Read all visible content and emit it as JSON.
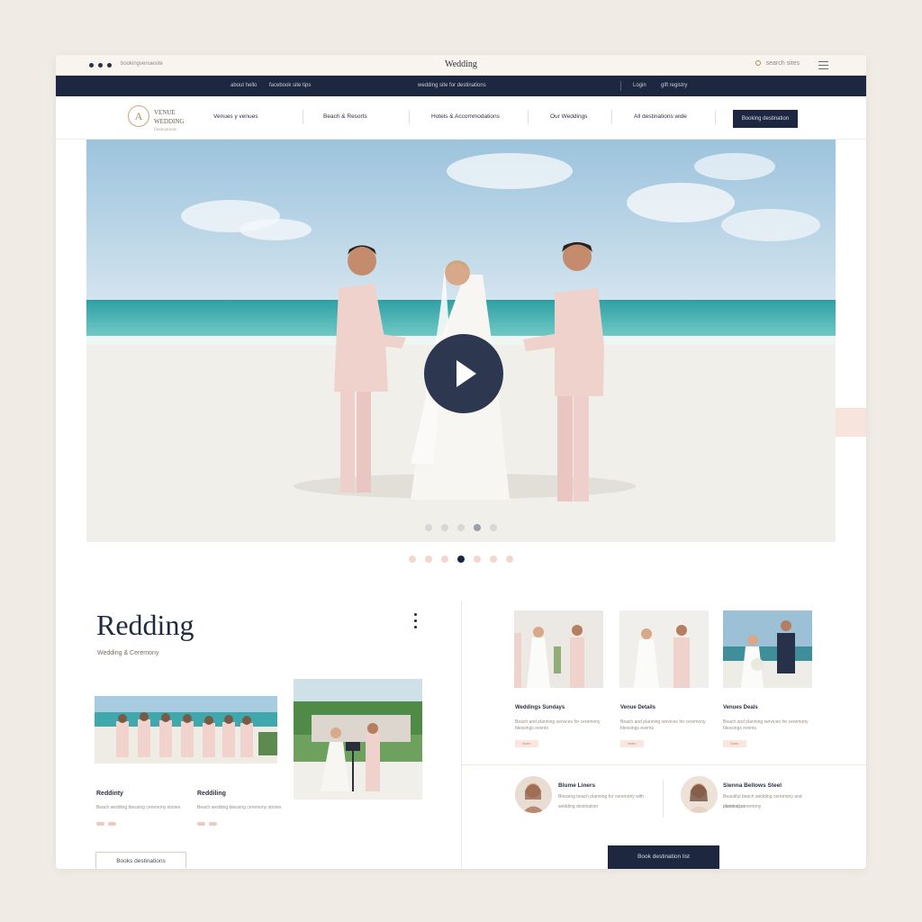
{
  "chrome": {
    "url": "bookingvenuesite",
    "title": "Wedding",
    "search_label": "search sites",
    "menu_icon": "hamburger-icon"
  },
  "topbar": {
    "item1": "about hello",
    "item2": "facebook site tips",
    "item3": "wedding site for destinations",
    "item4": "Login",
    "item5": "gift registry"
  },
  "nav": {
    "logo_mark": "A",
    "logo_line1": "VENUE",
    "logo_line2": "WEDDING",
    "logo_line3": "Destinations",
    "items": [
      "Venues y venues",
      "Beach & Resorts",
      "Hotels & Accommodations",
      "Our Weddings",
      "All destinations wide"
    ],
    "cta": "Booking destination"
  },
  "hero": {
    "play_icon": "play-icon",
    "active_slide": 4,
    "slide_count": 7
  },
  "left": {
    "heading": "Redding",
    "subheading": "Wedding & Ceremony",
    "col1_title": "Reddinty",
    "col1_text": "Beach wedding blessing ceremony stories",
    "col2_title": "Reddiling",
    "col2_text": "Beach wedding blessing ceremony stories",
    "outline_button": "Books destinations"
  },
  "cards": [
    {
      "title": "Weddings Sundays",
      "text": "Beach and planning services for ceremony blessings events",
      "tag": "learn"
    },
    {
      "title": "Venue Details",
      "text": "Beach and planning services for ceremony blessings events",
      "tag": "learn"
    },
    {
      "title": "Venues Deals",
      "text": "Beach and planning services for ceremony blessings events",
      "tag": "learn"
    }
  ],
  "testimonials": [
    {
      "name": "Blume Liners",
      "line1": "Blessing beach planning for ceremony with",
      "line2": "wedding destination"
    },
    {
      "name": "Sienna Bellows Steel",
      "line1": "Beautiful beach wedding ceremony and destination",
      "line2": "planning ceremony"
    }
  ],
  "primary_button": "Book destination list",
  "colors": {
    "navy": "#1d2740",
    "blush": "#f3d6cf",
    "gold": "#b08a56"
  }
}
